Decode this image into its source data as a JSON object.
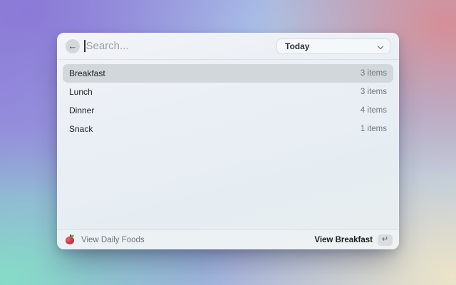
{
  "window": {
    "search": {
      "placeholder": "Search...",
      "value": ""
    },
    "filter": {
      "selected": "Today"
    },
    "list": {
      "selected_index": 0,
      "items": [
        {
          "label": "Breakfast",
          "count": "3 items"
        },
        {
          "label": "Lunch",
          "count": "3 items"
        },
        {
          "label": "Dinner",
          "count": "4 items"
        },
        {
          "label": "Snack",
          "count": "1 items"
        }
      ]
    },
    "footer": {
      "source_label": "View Daily Foods",
      "action_label": "View Breakfast",
      "enter_symbol": "↵"
    }
  },
  "icons": {
    "back_arrow": "←",
    "chevron": "chevron-down",
    "app_icon": "daily-foods-apple-icon",
    "enter_key": "return-key"
  },
  "colors": {
    "selection": "#d2d7db",
    "primary_text": "#1c1e21",
    "muted_text": "#73777d",
    "bg_purple": "#8b7ad7",
    "bg_pink": "#d68e96",
    "bg_teal": "#85dcc6",
    "bg_cream": "#ece3c8",
    "bg_blue": "#aecbe9"
  }
}
